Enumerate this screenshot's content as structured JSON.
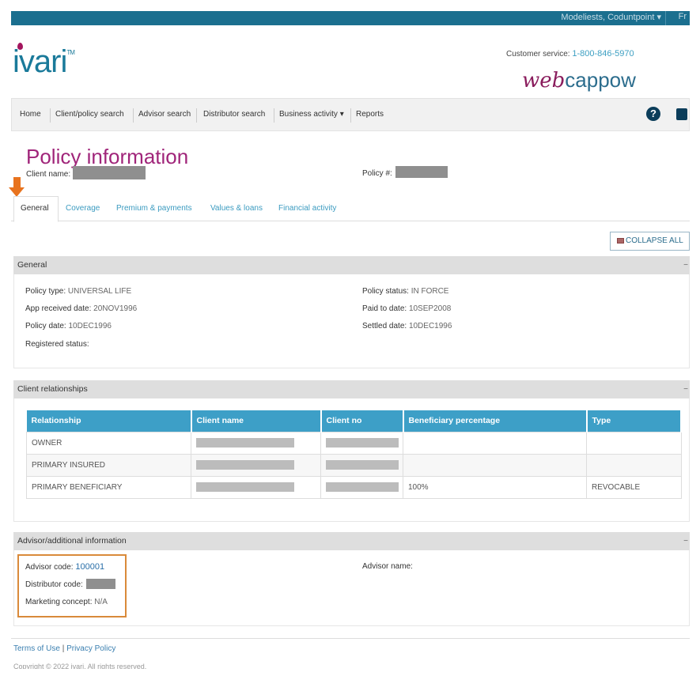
{
  "topbar": {
    "user_menu": "Modeliests, Coduntpoint ▾",
    "right_menu": "Fr"
  },
  "brand": {
    "logo": "ivari",
    "logo_tm": "TM",
    "customer_service_label": "Customer service:",
    "customer_service_phone": "1-800-846-5970",
    "app_name_prefix": "web",
    "app_name_suffix": "cappow"
  },
  "nav": {
    "items": [
      "Home",
      "Client/policy search",
      "Advisor search",
      "Distributor search",
      "Business activity ▾",
      "Reports"
    ]
  },
  "page": {
    "title": "Policy information",
    "client_name_label": "Client name:",
    "policy_num_label": "Policy #:"
  },
  "tabs": [
    "General",
    "Coverage",
    "Premium & payments",
    "Values & loans",
    "Financial activity"
  ],
  "collapse_all": "COLLAPSE ALL",
  "general": {
    "header": "General",
    "policy_type_label": "Policy type:",
    "policy_type": "UNIVERSAL LIFE",
    "app_received_label": "App received date:",
    "app_received": "20NOV1996",
    "policy_date_label": "Policy date:",
    "policy_date": "10DEC1996",
    "registered_status_label": "Registered status:",
    "policy_status_label": "Policy status:",
    "policy_status": "IN FORCE",
    "paid_to_label": "Paid to date:",
    "paid_to": "10SEP2008",
    "settled_label": "Settled date:",
    "settled": "10DEC1996"
  },
  "client_relationships": {
    "header": "Client relationships",
    "columns": [
      "Relationship",
      "Client name",
      "Client no",
      "Beneficiary percentage",
      "Type"
    ],
    "rows": [
      {
        "relationship": "OWNER",
        "percentage": "",
        "type": ""
      },
      {
        "relationship": "PRIMARY INSURED",
        "percentage": "",
        "type": ""
      },
      {
        "relationship": "PRIMARY BENEFICIARY",
        "percentage": "100%",
        "type": "REVOCABLE"
      }
    ]
  },
  "advisor": {
    "header": "Advisor/additional information",
    "advisor_code_label": "Advisor code:",
    "advisor_code": "100001",
    "distributor_code_label": "Distributor code:",
    "marketing_concept_label": "Marketing concept:",
    "marketing_concept": "N/A",
    "advisor_name_label": "Advisor name:"
  },
  "footer": {
    "terms": "Terms of Use",
    "separator": "|",
    "privacy": "Privacy Policy",
    "copyright": "Copyright © 2022 ivari. All rights reserved."
  },
  "colors": {
    "topbar": "#1b6f8f",
    "title": "#a0257a",
    "table_header": "#3d9fc7",
    "highlight": "#d98a3a",
    "arrow": "#e8731e"
  }
}
